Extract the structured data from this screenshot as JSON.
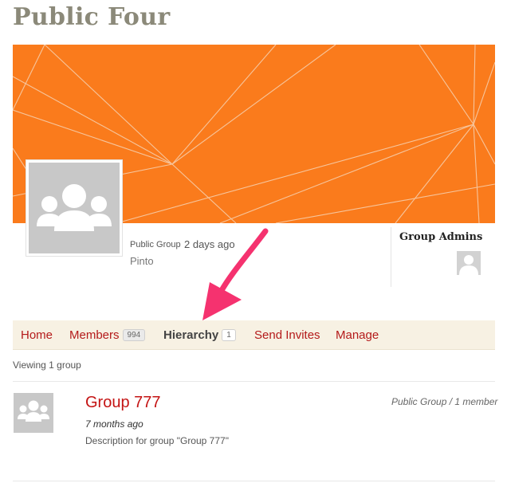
{
  "page": {
    "title": "Public Four"
  },
  "group_header": {
    "type_label": "Public Group",
    "last_active": "2 days ago",
    "name_sub": "Pinto",
    "admins_title": "Group Admins",
    "cover_color": "#fa7b1c",
    "avatar_icon": "group-people-icon",
    "admin_avatar_icon": "person-icon"
  },
  "nav": {
    "home": "Home",
    "members": "Members",
    "members_count": "994",
    "hierarchy": "Hierarchy",
    "hierarchy_count": "1",
    "send_invites": "Send Invites",
    "manage": "Manage",
    "link_color": "#b41a1a",
    "background": "#f7f1e3"
  },
  "listing": {
    "viewing_text": "Viewing 1 group",
    "items": [
      {
        "title": "Group 777",
        "meta": "Public Group / 1 member",
        "time": "7 months ago",
        "description": "Description for group \"Group 777\"",
        "avatar_icon": "group-people-icon"
      }
    ]
  },
  "annotation": {
    "arrow_color": "#f5326f",
    "arrow_icon": "arrow-annotation-icon"
  }
}
